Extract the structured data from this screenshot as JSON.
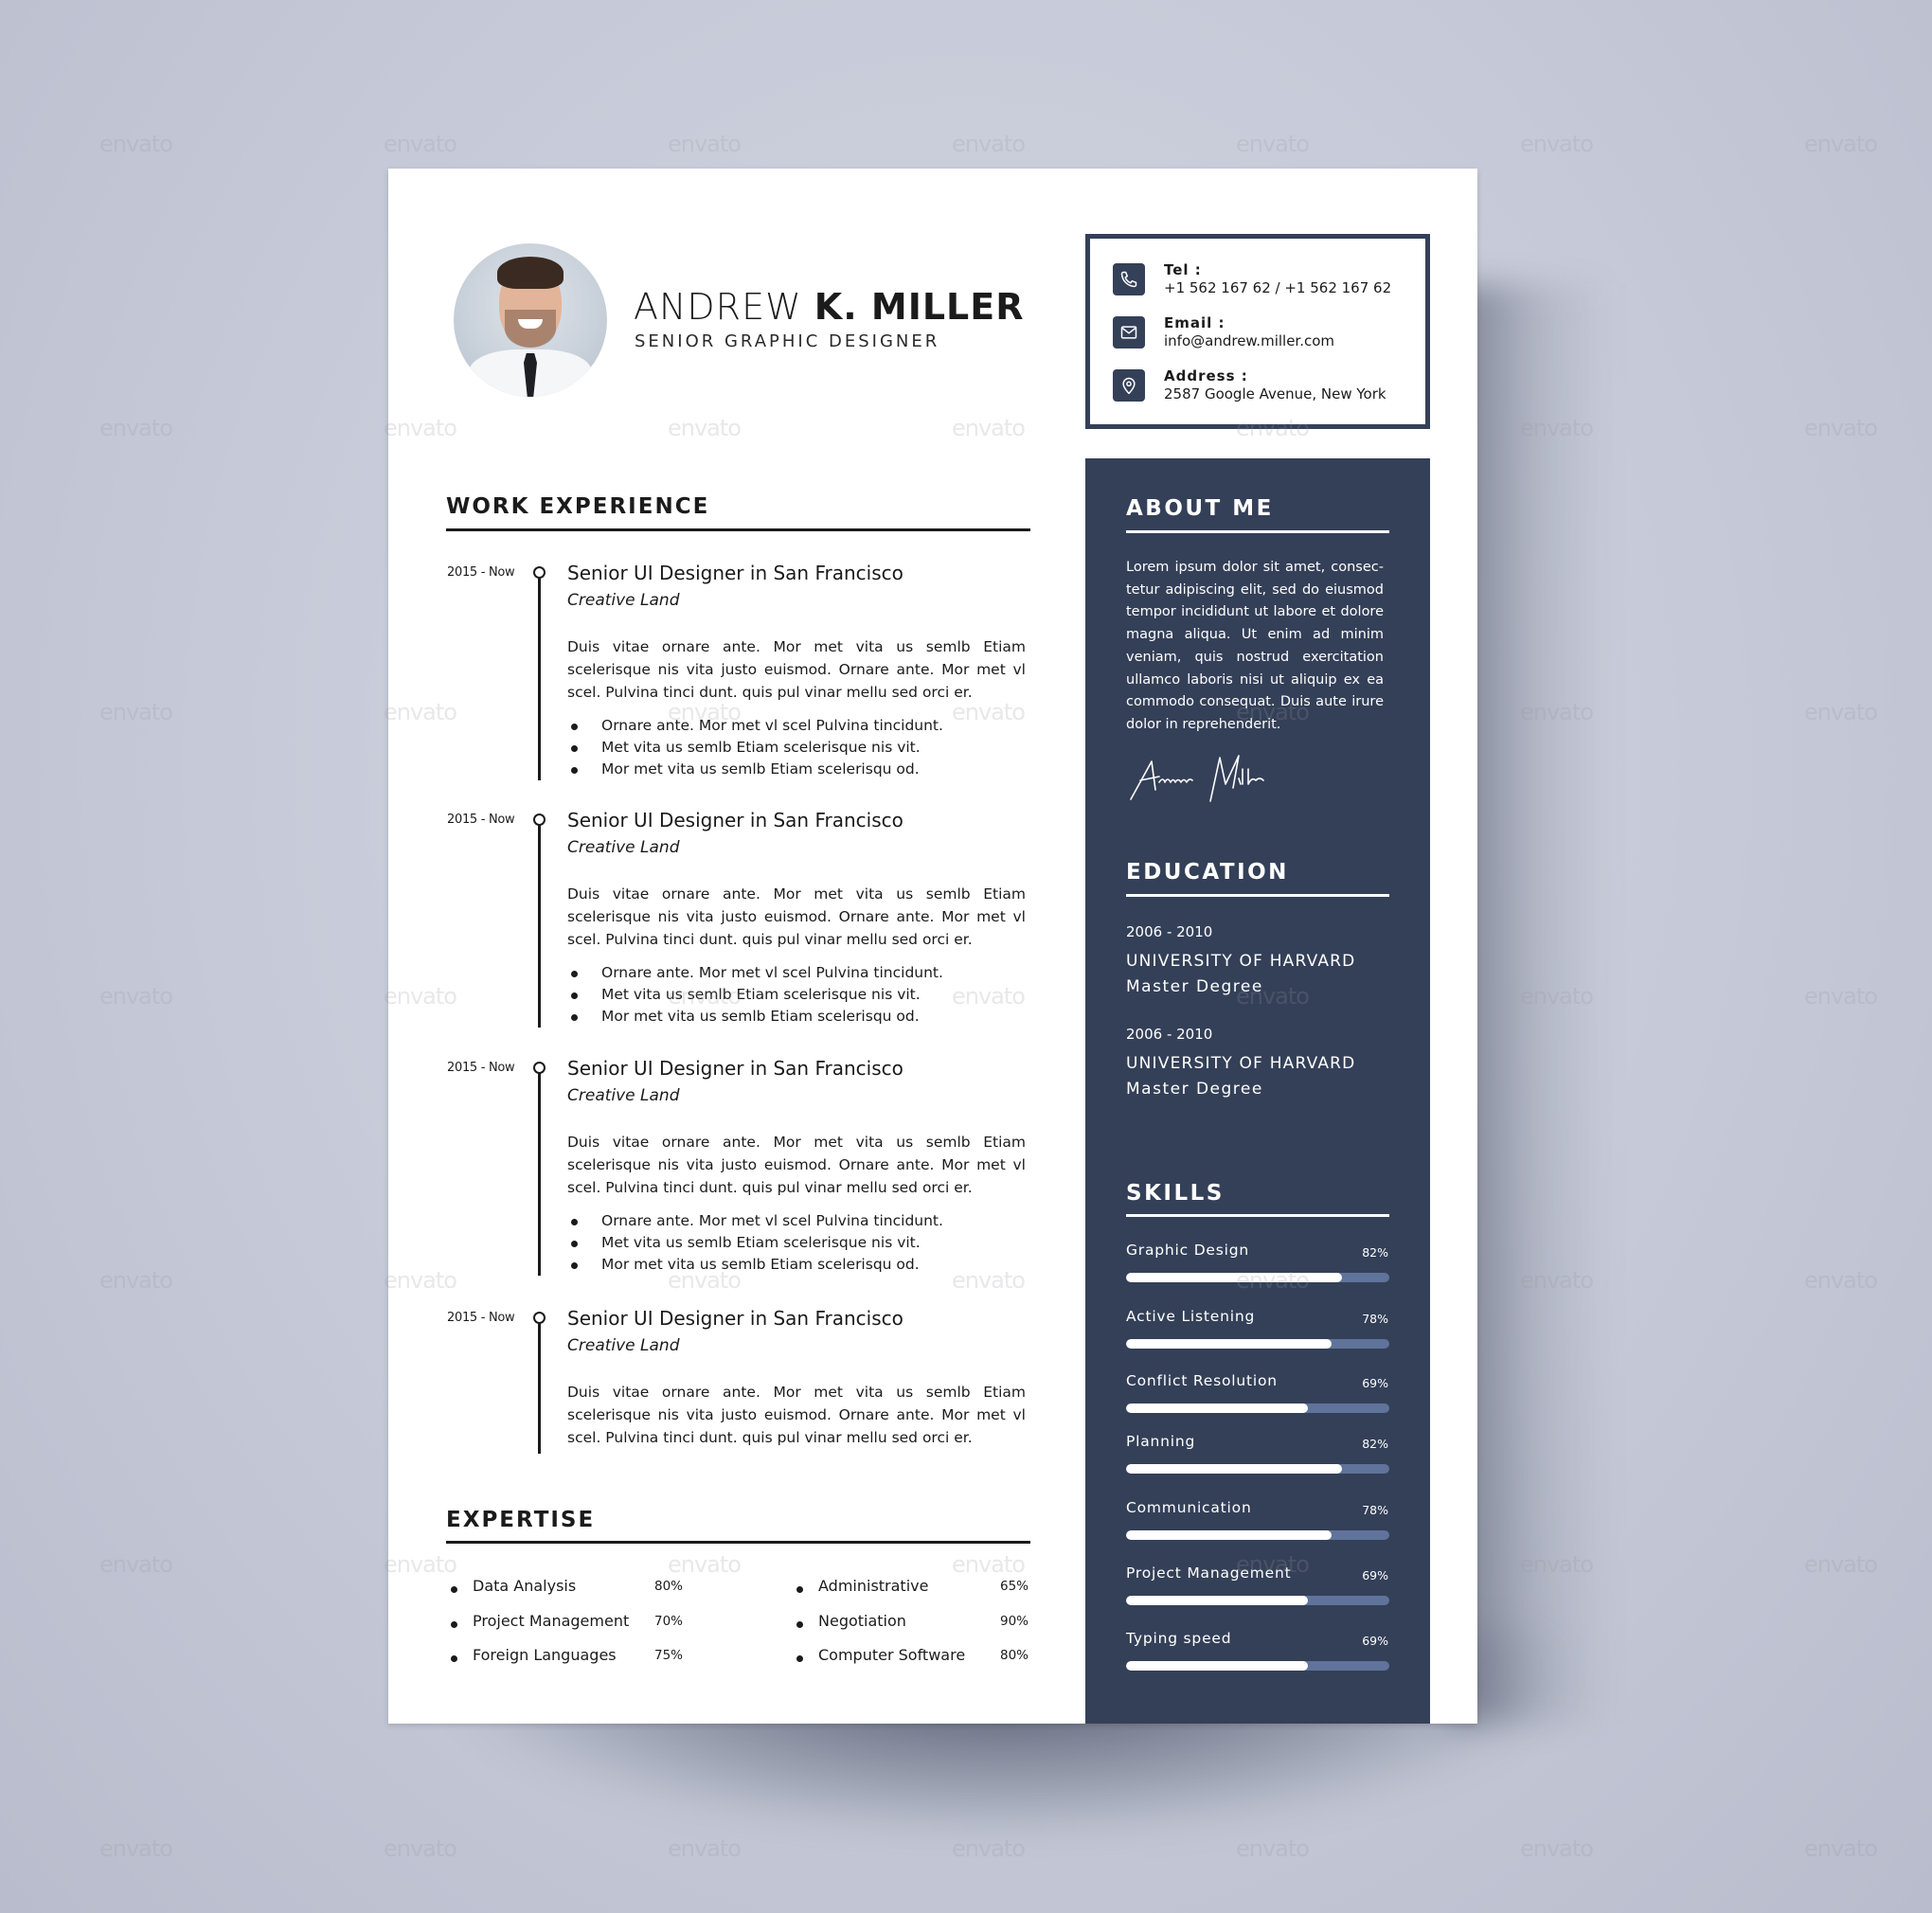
{
  "profile": {
    "first_name": "ANDREW",
    "last_name": "K. MILLER",
    "title": "SENIOR GRAPHIC DESIGNER",
    "photo_alt": "profile-photo"
  },
  "contact": {
    "tel_label": "Tel :",
    "tel_value": "+1 562 167 62 / +1 562 167 62",
    "email_label": "Email :",
    "email_value": "info@andrew.miller.com",
    "address_label": "Address :",
    "address_value": "2587 Google Avenue, New York",
    "icons": [
      "phone-icon",
      "mail-icon",
      "map-pin-icon"
    ]
  },
  "work_experience": {
    "heading": "WORK EXPERIENCE",
    "jobs": [
      {
        "date": "2015 - Now",
        "title": "Senior UI Designer in San Francisco",
        "company": "Creative Land",
        "description": "Duis vitae ornare ante. Mor met vita us semlb Etiam scelerisque nis vita justo euismod. Ornare ante. Mor met vl scel. Pulvina tinci dunt. quis pul vinar mellu sed orci er.",
        "bullets": [
          "Ornare ante. Mor met vl scel Pulvina tincidunt.",
          "Met vita us semlb Etiam scelerisque nis vit.",
          "Mor met vita us semlb Etiam scelerisqu od."
        ]
      },
      {
        "date": "2015 - Now",
        "title": "Senior UI Designer in San Francisco",
        "company": "Creative Land",
        "description": "Duis vitae ornare ante. Mor met vita us semlb Etiam scelerisque nis vita justo euismod. Ornare ante. Mor met vl scel. Pulvina tinci dunt. quis pul vinar mellu sed orci er.",
        "bullets": [
          "Ornare ante. Mor met vl scel Pulvina tincidunt.",
          "Met vita us semlb Etiam scelerisque nis vit.",
          "Mor met vita us semlb Etiam scelerisqu od."
        ]
      },
      {
        "date": "2015 - Now",
        "title": "Senior UI Designer in San Francisco",
        "company": "Creative Land",
        "description": "Duis vitae ornare ante. Mor met vita us semlb Etiam scelerisque nis vita justo euismod. Ornare ante. Mor met vl scel. Pulvina tinci dunt. quis pul vinar mellu sed orci er.",
        "bullets": [
          "Ornare ante. Mor met vl scel Pulvina tincidunt.",
          "Met vita us semlb Etiam scelerisque nis vit.",
          "Mor met vita us semlb Etiam scelerisqu od."
        ]
      },
      {
        "date": "2015 - Now",
        "title": "Senior UI Designer in San Francisco",
        "company": "Creative Land",
        "description": "Duis vitae ornare ante. Mor met vita us semlb Etiam scelerisque nis vita justo euismod. Ornare ante. Mor met vl scel. Pulvina tinci dunt. quis pul vinar mellu sed orci er.",
        "bullets": []
      }
    ]
  },
  "expertise": {
    "heading": "EXPERTISE",
    "items": [
      {
        "name": "Data Analysis",
        "value": "80%"
      },
      {
        "name": "Project Management",
        "value": "70%"
      },
      {
        "name": "Foreign Languages",
        "value": "75%"
      },
      {
        "name": "Administrative",
        "value": "65%"
      },
      {
        "name": "Negotiation",
        "value": "90%"
      },
      {
        "name": "Computer Software",
        "value": "80%"
      }
    ]
  },
  "about": {
    "heading": "ABOUT ME",
    "text": "Lorem ipsum dolor sit amet, consec­tetur adipiscing elit, sed do eiusmod tempor incididunt ut labore et dolore magna aliqua. Ut enim ad minim veniam, quis nostrud exerci­tation ullamco laboris nisi ut aliquip ex ea commodo consequat. Duis aute irure dolor in reprehenderit.",
    "signature": "Andrew Miller"
  },
  "education": {
    "heading": "EDUCATION",
    "entries": [
      {
        "years": "2006 - 2010",
        "school": "UNIVERSITY OF HARVARD",
        "degree": "Master Degree"
      },
      {
        "years": "2006 - 2010",
        "school": "UNIVERSITY OF HARVARD",
        "degree": "Master Degree"
      }
    ]
  },
  "skills": {
    "heading": "SKILLS",
    "items": [
      {
        "name": "Graphic Design",
        "label": "82%",
        "percent": 82
      },
      {
        "name": "Active Listening",
        "label": "78%",
        "percent": 78
      },
      {
        "name": "Conflict Resolution",
        "label": "69%",
        "percent": 69
      },
      {
        "name": "Planning",
        "label": "82%",
        "percent": 82
      },
      {
        "name": "Communication",
        "label": "78%",
        "percent": 78
      },
      {
        "name": "Project Management",
        "label": "69%",
        "percent": 69
      },
      {
        "name": "Typing speed",
        "label": "69%",
        "percent": 69
      }
    ]
  },
  "watermark": "envato",
  "colors": {
    "navy": "#344058",
    "bar_track": "#60739a",
    "text": "#1b1b1b",
    "background": "#c6cad8"
  }
}
